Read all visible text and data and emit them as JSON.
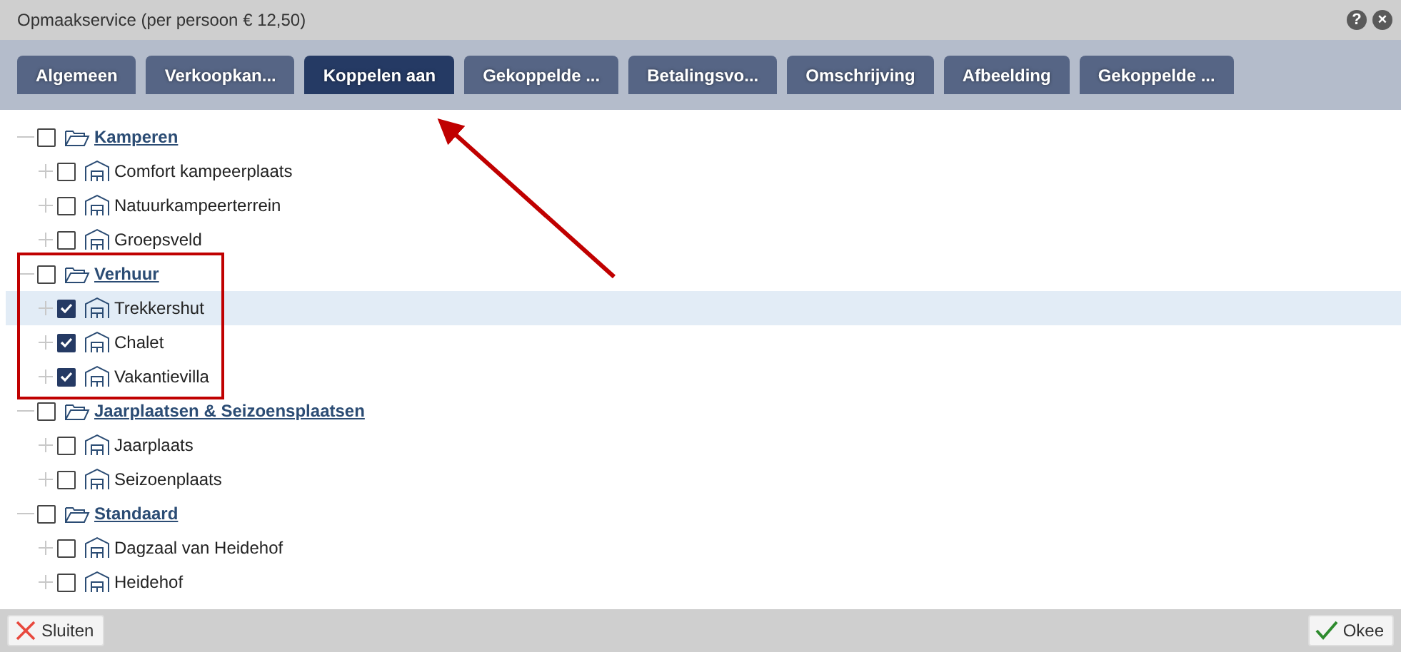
{
  "window": {
    "title": "Opmaakservice (per persoon € 12,50)",
    "help": "?",
    "close": "×"
  },
  "tabs": [
    {
      "label": "Algemeen",
      "selected": false
    },
    {
      "label": "Verkoopkan...",
      "selected": false
    },
    {
      "label": "Koppelen aan",
      "selected": true
    },
    {
      "label": "Gekoppelde ...",
      "selected": false
    },
    {
      "label": "Betalingsvo...",
      "selected": false
    },
    {
      "label": "Omschrijving",
      "selected": false
    },
    {
      "label": "Afbeelding",
      "selected": false
    },
    {
      "label": "Gekoppelde ...",
      "selected": false
    }
  ],
  "tree": [
    {
      "label": "Kamperen",
      "checked": false,
      "selected": false,
      "children": [
        {
          "label": "Comfort kampeerplaats",
          "checked": false,
          "selected": false
        },
        {
          "label": "Natuurkampeerterrein",
          "checked": false,
          "selected": false
        },
        {
          "label": "Groepsveld",
          "checked": false,
          "selected": false
        }
      ]
    },
    {
      "label": "Verhuur",
      "checked": false,
      "selected": false,
      "children": [
        {
          "label": "Trekkershut",
          "checked": true,
          "selected": true
        },
        {
          "label": "Chalet",
          "checked": true,
          "selected": false
        },
        {
          "label": "Vakantievilla",
          "checked": true,
          "selected": false
        }
      ]
    },
    {
      "label": "Jaarplaatsen & Seizoensplaatsen",
      "checked": false,
      "selected": false,
      "children": [
        {
          "label": "Jaarplaats",
          "checked": false,
          "selected": false
        },
        {
          "label": "Seizoenplaats",
          "checked": false,
          "selected": false
        }
      ]
    },
    {
      "label": "Standaard",
      "checked": false,
      "selected": false,
      "children": [
        {
          "label": "Dagzaal van Heidehof",
          "checked": false,
          "selected": false
        },
        {
          "label": "Heidehof",
          "checked": false,
          "selected": false
        }
      ]
    }
  ],
  "footer": {
    "close_button": "Sluiten",
    "ok_button": "Okee"
  }
}
